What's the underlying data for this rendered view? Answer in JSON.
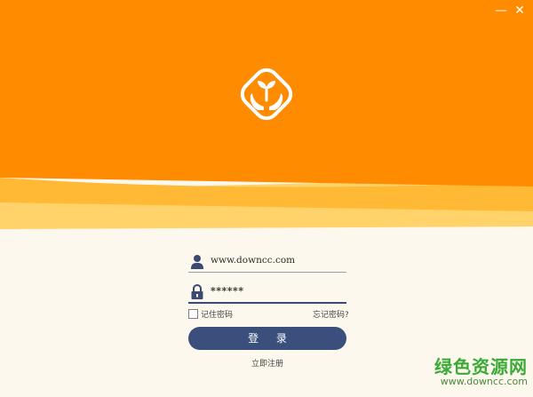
{
  "window": {
    "minimize_glyph": "—",
    "close_glyph": "✕"
  },
  "colors": {
    "header_orange": "#ff8c00",
    "wave_mid": "#ffb935",
    "wave_light": "#ffd36a",
    "background": "#fdf8ee",
    "primary_button": "#3b4f7d"
  },
  "logo": {
    "icon": "sprout-hands-icon"
  },
  "form": {
    "username": {
      "value": "www.downcc.com",
      "icon": "user-icon"
    },
    "password": {
      "value": "******",
      "icon": "lock-icon"
    },
    "remember_label": "记住密码",
    "remember_checked": false,
    "forgot_label": "忘记密码?",
    "login_label": "登 录",
    "register_label": "立即注册"
  },
  "watermark": {
    "text": "绿色资源网",
    "url": "www.downcc.com"
  }
}
